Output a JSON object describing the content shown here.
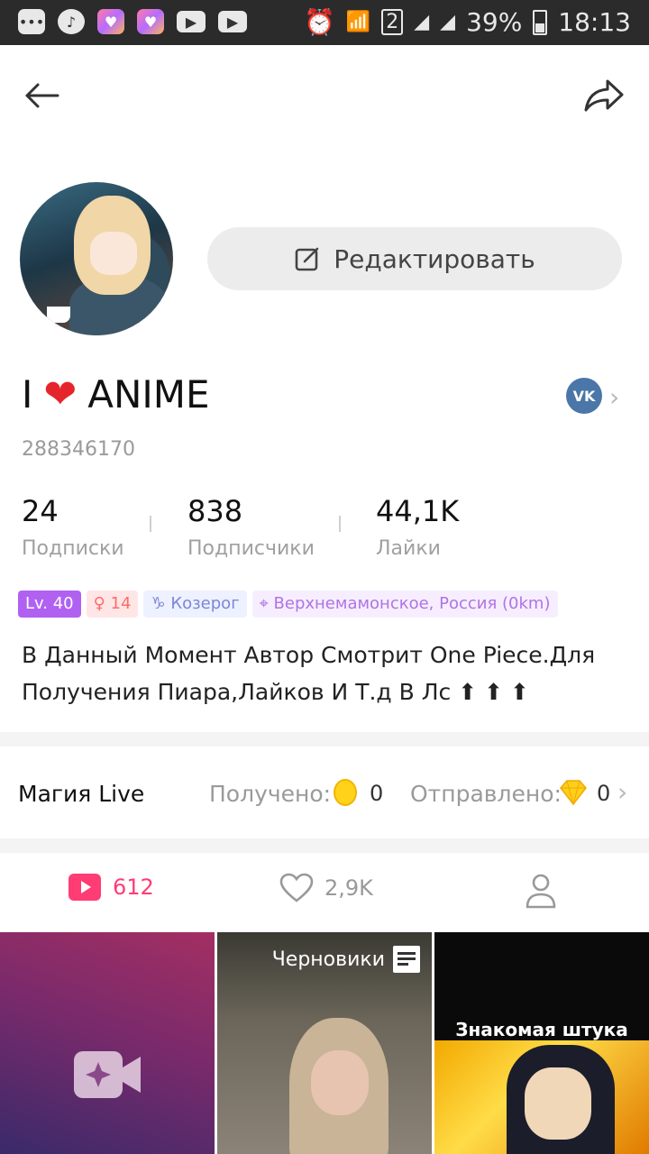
{
  "status_bar": {
    "battery": "39%",
    "time": "18:13",
    "sim": "2",
    "icons": [
      "chat-icon",
      "music-icon",
      "likee-icon",
      "likee-icon",
      "youtube-icon",
      "youtube-icon",
      "alarm-icon",
      "wifi-icon",
      "signal-icon",
      "signal-icon",
      "battery-icon"
    ]
  },
  "toolbar": {
    "back_icon": "arrow-left-icon",
    "share_icon": "share-icon"
  },
  "profile": {
    "edit_label": "Редактировать",
    "name_part1": "I",
    "name_heart": "❤",
    "name_part2": "ANIME",
    "user_id": "288346170",
    "social": "VK"
  },
  "stats": [
    {
      "value": "24",
      "label": "Подписки"
    },
    {
      "value": "838",
      "label": "Подписчики"
    },
    {
      "value": "44,1K",
      "label": "Лайки"
    }
  ],
  "tags": {
    "level": "Lv. 40",
    "fans": "14",
    "zodiac": "Козерог",
    "location": "Верхнемамонское, Россия (0km)"
  },
  "bio": "В Данный Момент Автор Смотрит One Piece.Для Получения Пиара,Лайков И Т.д В Лс ⬆ ⬆ ⬆",
  "magic": {
    "title": "Магия Live",
    "received_label": "Получено:",
    "received_value": "0",
    "sent_label": "Отправлено:",
    "sent_value": "0"
  },
  "tabs": {
    "videos_count": "612",
    "likes_count": "2,9K"
  },
  "grid": {
    "drafts_label": "Черновики",
    "meme_caption": "Знакомая штука"
  },
  "colors": {
    "accent": "#ff3c74",
    "level_tag": "#b061f2",
    "vk": "#4a76a8"
  }
}
